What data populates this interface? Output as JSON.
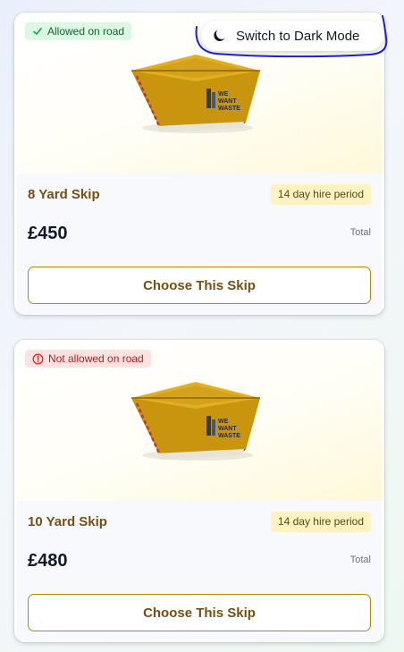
{
  "theme_toggle": {
    "label": "Switch to Dark Mode",
    "icon": "moon-icon"
  },
  "colors": {
    "accent": "#b8860b",
    "title_text": "#7a4e10",
    "allowed_bg": "#dcf7e3",
    "allowed_text": "#166534",
    "not_allowed_bg": "#fde2e2",
    "not_allowed_text": "#b91c1c",
    "hire_bg": "#fdf3c2",
    "annotation_stroke": "#1a1fd6"
  },
  "skips": [
    {
      "badge": "Allowed on road",
      "badge_icon": "check-icon",
      "title": "8 Yard Skip",
      "hire_period": "14 day hire period",
      "price": "£450",
      "price_note": "Total",
      "cta": "Choose This Skip",
      "image_logo": [
        "WE",
        "WANT",
        "WASTE"
      ]
    },
    {
      "badge": "Not allowed on road",
      "badge_icon": "alert-circle-icon",
      "title": "10 Yard Skip",
      "hire_period": "14 day hire period",
      "price": "£480",
      "price_note": "Total",
      "cta": "Choose This Skip",
      "image_logo": [
        "WE",
        "WANT",
        "WASTE"
      ]
    }
  ]
}
